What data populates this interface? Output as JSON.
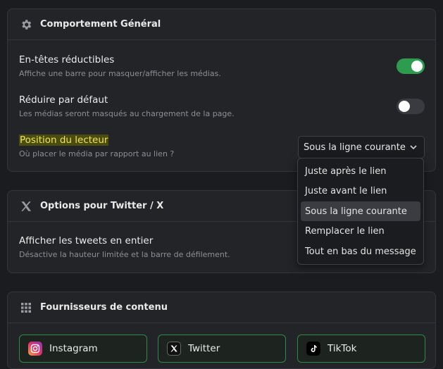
{
  "general": {
    "title": "Comportement Général",
    "collapsible": {
      "label": "En-têtes réductibles",
      "desc": "Affiche une barre pour masquer/afficher les médias.",
      "enabled": true
    },
    "collapse_default": {
      "label": "Réduire par défaut",
      "desc": "Les médias seront masqués au chargement de la page.",
      "enabled": false
    },
    "player_position": {
      "label": "Position du lecteur",
      "desc": "Où placer le média par rapport au lien ?",
      "selected": "Sous la ligne courante",
      "options": [
        "Juste après le lien",
        "Juste avant le lien",
        "Sous la ligne courante",
        "Remplacer le lien",
        "Tout en bas du message"
      ]
    }
  },
  "twitter": {
    "title": "Options pour Twitter / X",
    "full_tweets": {
      "label": "Afficher les tweets en entier",
      "desc": "Désactive la hauteur limitée et la barre de défilement."
    }
  },
  "providers": {
    "title": "Fournisseurs de contenu",
    "items": [
      "Instagram",
      "Twitter",
      "TikTok"
    ]
  },
  "colors": {
    "accent": "#2e9c4f",
    "highlight": "#f1e55b"
  }
}
